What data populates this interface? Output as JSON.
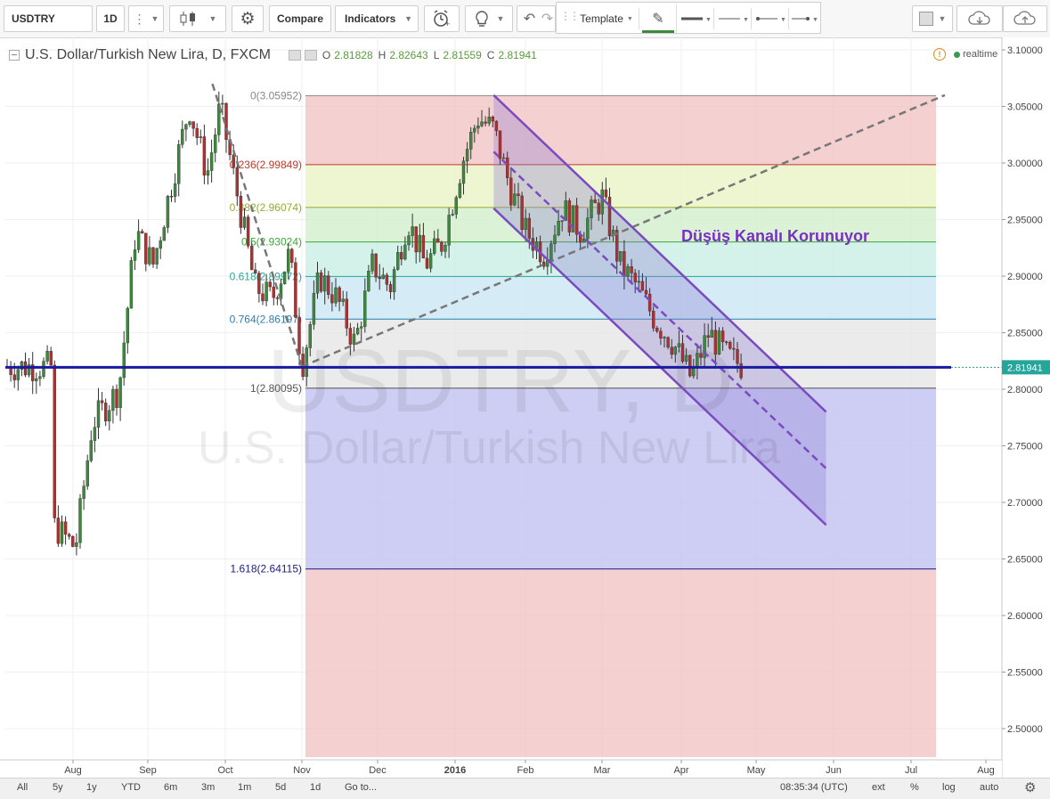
{
  "toolbar": {
    "symbol": "USDTRY",
    "interval": "1D",
    "compare_label": "Compare",
    "indicators_label": "Indicators",
    "template_label": "Template"
  },
  "legend": {
    "title": "U.S. Dollar/Turkish New Lira, D, FXCM",
    "o_label": "O",
    "o": "2.81828",
    "h_label": "H",
    "h": "2.82643",
    "l_label": "L",
    "l": "2.81559",
    "c_label": "C",
    "c": "2.81941",
    "realtime": "realtime"
  },
  "watermark": {
    "symbol": "USDTRY, D",
    "name": "U.S. Dollar/Turkish New Lira"
  },
  "annotation": "Düşüş Kanalı Korunuyor",
  "bottom": {
    "ranges": [
      "All",
      "5y",
      "1y",
      "YTD",
      "6m",
      "3m",
      "1m",
      "5d",
      "1d"
    ],
    "goto": "Go to...",
    "time": "08:35:34 (UTC)",
    "ext": "ext",
    "pct": "%",
    "log": "log",
    "auto": "auto"
  },
  "colors": {
    "up": "#3b8a3b",
    "down": "#b03030",
    "price_line": "#1a1aa0",
    "channel": "#7a4bc0",
    "annotation": "#7a2fc4"
  },
  "chart_data": {
    "type": "candlestick",
    "symbol": "USDTRY",
    "timeframe": "D",
    "y_axis": {
      "ticks": [
        "3.10000",
        "3.05000",
        "3.00000",
        "2.95000",
        "2.90000",
        "2.85000",
        "2.80000",
        "2.75000",
        "2.70000",
        "2.65000",
        "2.60000",
        "2.55000",
        "2.50000"
      ],
      "last_price": "2.81941"
    },
    "x_axis": {
      "ticks": [
        "Aug",
        "Sep",
        "Oct",
        "Nov",
        "Dec",
        "2016",
        "Feb",
        "Mar",
        "Apr",
        "May",
        "Jun",
        "Jul",
        "Aug"
      ]
    },
    "fibonacci": [
      {
        "level": "0",
        "price": "3.05952",
        "text": "0(3.05952)",
        "color": "#888888"
      },
      {
        "level": "0.236",
        "price": "2.99849",
        "text": "0.236(2.99849)",
        "color": "#c0392b"
      },
      {
        "level": "0.382",
        "price": "2.96074",
        "text": "0.382(2.96074)",
        "color": "#9aa82a"
      },
      {
        "level": "0.5",
        "price": "2.93024",
        "text": "0.5(2.93024)",
        "color": "#3aa83a"
      },
      {
        "level": "0.618",
        "price": "2.89972",
        "text": "0.618(2.89972)",
        "color": "#26a69a"
      },
      {
        "level": "0.764",
        "price": "2.86197",
        "text": "0.764(2.86197)",
        "color": "#2b7fb0"
      },
      {
        "level": "1",
        "price": "2.80095",
        "text": "1(2.80095)",
        "color": "#555555"
      },
      {
        "level": "1.618",
        "price": "2.64115",
        "text": "1.618(2.64115)",
        "color": "#1b1b8a"
      }
    ],
    "price_path": [
      [
        "Jul 24",
        2.68
      ],
      [
        "Aug 2",
        2.66
      ],
      [
        "Aug 9",
        2.77
      ],
      [
        "Aug 20",
        2.8
      ],
      [
        "Aug 27",
        2.94
      ],
      [
        "Sep 3",
        2.91
      ],
      [
        "Sep 10",
        2.98
      ],
      [
        "Sep 17",
        3.05
      ],
      [
        "Sep 24",
        2.99
      ],
      [
        "Sep 29",
        3.05
      ],
      [
        "Oct 6",
        2.97
      ],
      [
        "Oct 13",
        2.89
      ],
      [
        "Oct 20",
        2.88
      ],
      [
        "Oct 27",
        2.92
      ],
      [
        "Nov 1",
        2.82
      ],
      [
        "Nov 8",
        2.9
      ],
      [
        "Nov 15",
        2.88
      ],
      [
        "Nov 22",
        2.84
      ],
      [
        "Nov 29",
        2.91
      ],
      [
        "Dec 6",
        2.89
      ],
      [
        "Dec 13",
        2.95
      ],
      [
        "Dec 20",
        2.91
      ],
      [
        "Dec 27",
        2.93
      ],
      [
        "Jan 4",
        3.0
      ],
      [
        "Jan 11",
        3.04
      ],
      [
        "Jan 18",
        3.03
      ],
      [
        "Jan 25",
        2.98
      ],
      [
        "Feb 1",
        2.94
      ],
      [
        "Feb 8",
        2.92
      ],
      [
        "Feb 15",
        2.96
      ],
      [
        "Feb 22",
        2.94
      ],
      [
        "Mar 1",
        2.97
      ],
      [
        "Mar 8",
        2.91
      ],
      [
        "Mar 15",
        2.89
      ],
      [
        "Mar 22",
        2.86
      ],
      [
        "Mar 29",
        2.84
      ],
      [
        "Apr 5",
        2.81
      ],
      [
        "Apr 12",
        2.85
      ],
      [
        "Apr 19",
        2.83
      ],
      [
        "Apr 26",
        2.82
      ]
    ],
    "channel_lines": [
      {
        "from": [
          "Jan 18",
          3.06
        ],
        "to": [
          "May 29",
          2.78
        ]
      },
      {
        "from": [
          "Jan 18",
          3.01
        ],
        "to": [
          "May 29",
          2.73
        ]
      },
      {
        "from": [
          "Jan 18",
          2.96
        ],
        "to": [
          "May 29",
          2.68
        ]
      }
    ],
    "trend_lines": [
      {
        "from": [
          "Sep 26",
          3.07
        ],
        "to": [
          "Nov 1",
          2.82
        ]
      },
      {
        "from": [
          "Nov 1",
          2.82
        ],
        "to": [
          "Jul 15",
          3.06
        ]
      }
    ]
  }
}
